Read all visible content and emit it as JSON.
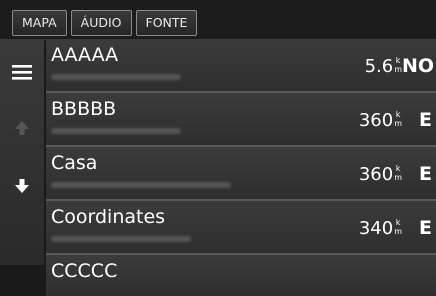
{
  "tabs": [
    {
      "label": "MAPA"
    },
    {
      "label": "ÁUDIO"
    },
    {
      "label": "FONTE"
    }
  ],
  "sidebar": {
    "menu_icon": "menu-icon",
    "up_icon": "arrow-up-icon",
    "down_icon": "arrow-down-icon"
  },
  "results": [
    {
      "name": "AAAAA",
      "distance": "5.6",
      "unit_top": "k",
      "unit_bottom": "m",
      "direction": "NO"
    },
    {
      "name": "BBBBB",
      "distance": "360",
      "unit_top": "k",
      "unit_bottom": "m",
      "direction": "E"
    },
    {
      "name": "Casa",
      "distance": "360",
      "unit_top": "k",
      "unit_bottom": "m",
      "direction": "E"
    },
    {
      "name": "Coordinates",
      "distance": "340",
      "unit_top": "k",
      "unit_bottom": "m",
      "direction": "E"
    },
    {
      "name": "CCCCC"
    }
  ],
  "colors": {
    "background": "#1a1a1a",
    "row": "#333333",
    "text": "#ffffff"
  }
}
